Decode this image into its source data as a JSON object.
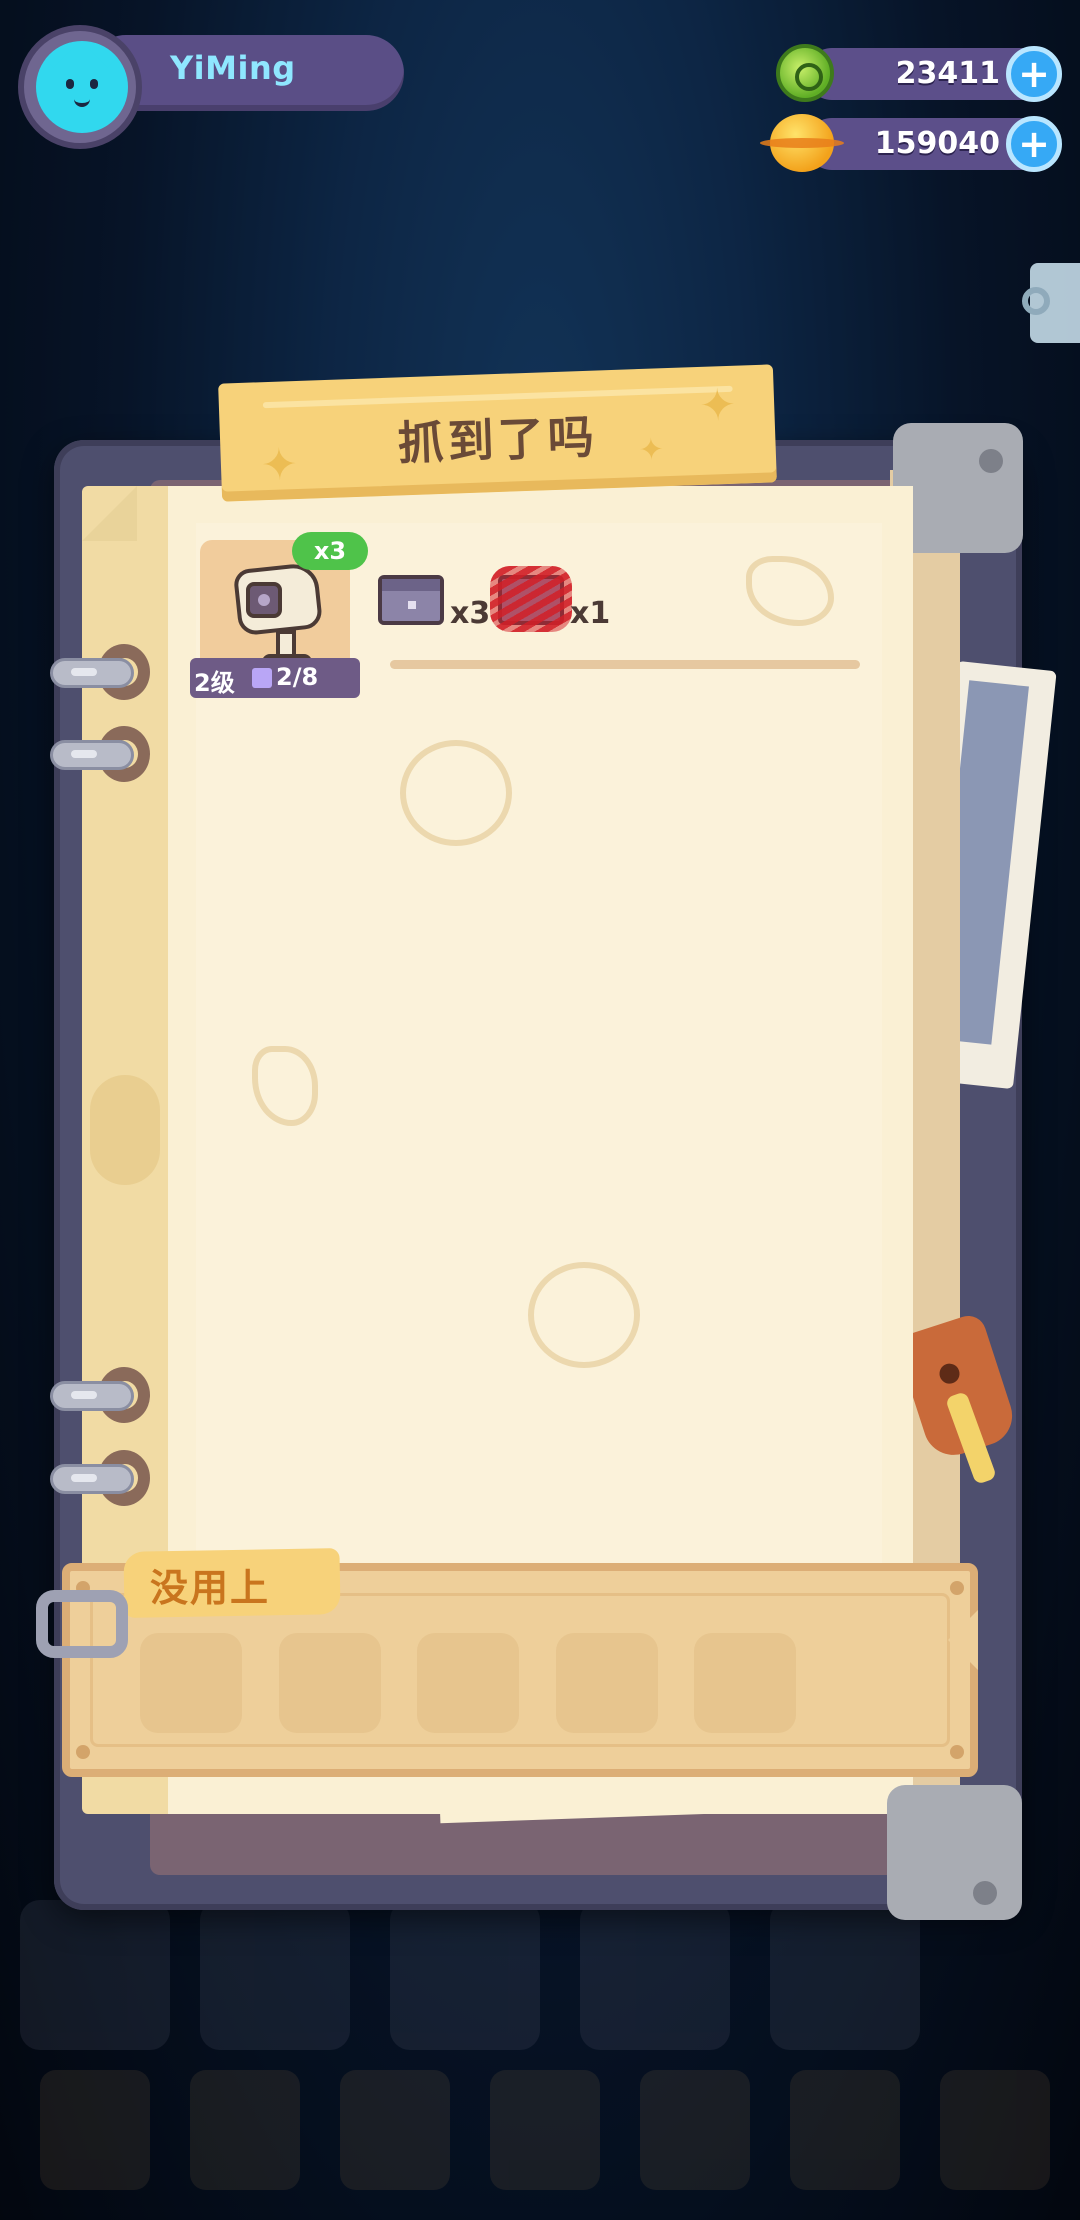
{
  "player": {
    "name": "YiMing"
  },
  "currencies": [
    {
      "name": "green-gem",
      "amount": "23411"
    },
    {
      "name": "gold-planet",
      "amount": "159040"
    }
  ],
  "dialog": {
    "title": "抓到了吗",
    "caught_item": {
      "count_badge": "x3",
      "level": "2级",
      "progress": "2/8"
    },
    "rewards": [
      {
        "icon": "purple-box-icon",
        "quantity": "x3"
      },
      {
        "icon": "scribbled-item-icon",
        "quantity": "x1"
      }
    ],
    "unused_section": {
      "label": "没用上",
      "slots": 5
    }
  },
  "colors": {
    "accent_green": "#4fc34a",
    "plus_button": "#36a9f5",
    "name_text": "#8fe7ff",
    "panel": "#eecf9a"
  }
}
